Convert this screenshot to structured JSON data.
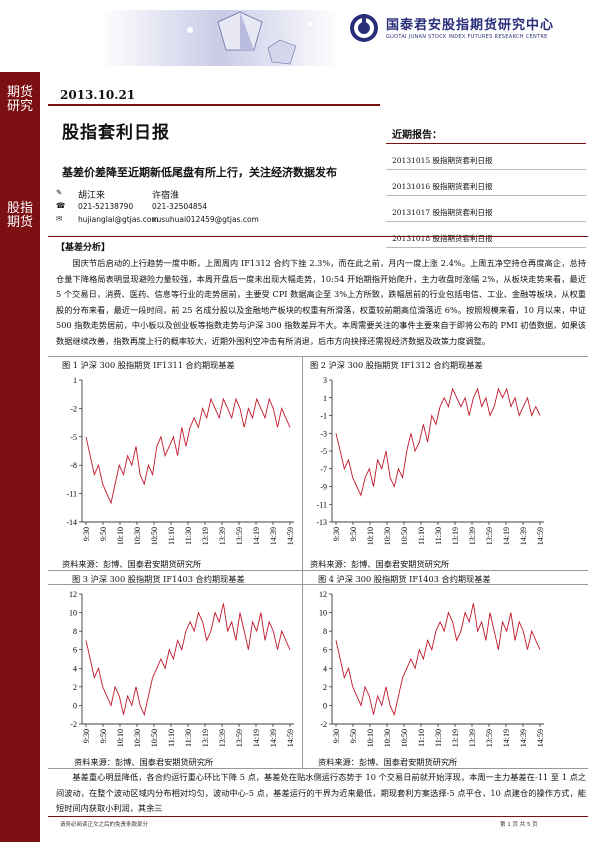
{
  "header": {
    "logo_cn": "国泰君安股指期货研究中心",
    "logo_en": "GUOTAI JUNAN STOCK INDEX FUTURES RESEARCH CENTRE"
  },
  "left_band": {
    "top": "期货研究",
    "bottom": "股指期货"
  },
  "date": "2013.10.21",
  "title": "股指套利日报",
  "subtitle": "基差价差降至近期新低尾盘有所上行，关注经济数据发布",
  "analysts": [
    {
      "name": "胡江来",
      "phone": "021-52138790",
      "email": "hujianglai@gtjas.com"
    },
    {
      "name": "许宿淮",
      "phone": "021-32504854",
      "email": "xusuhuai012459@gtjas.com"
    }
  ],
  "recent": {
    "heading": "近期报告：",
    "items": [
      "20131015 股指期货套利日报",
      "20131016 股指期货套利日报",
      "20131017 股指期货套利日报",
      "20131018 股指期货套利日报"
    ]
  },
  "section_heading": "【基差分析】",
  "para1": "国庆节后启动的上行趋势一度中断，上周周内 IF1312 合约下挫 2.3%，而在此之前，月内一度上涨 2.4%。上周五净空持仓再度高企，总持仓量下降格局表明显现避险力量较强，本周开盘后一度未出现大幅走势，10:54 开始期指开始爬升，主力收盘时涨幅 2%，从板块走势来看，最近 5 个交易日，消费、医药、信息等行业的走势居前，主要受 CPI 数据高企至 3%上方所致，跌幅居前的行业包括电信、工业、金融等板块，从权重股的分布来看，最近一段时间，前 25 名成分股以及金融地产板块的权重有所滑落，权重较前期高位滑落近 6%。按照规模来看，10 月以来，中证 500 指数走势居前，中小板以及创业板等指数走势与沪深 300 指数差异不大。本周需要关注的事件主要来自于即将公布的 PMI 初值数据，如果该数据继续改善，指数再度上行的概率较大，近期外围利空冲击有所消退，后市方向抉择还需视经济数据及政策力度调整。",
  "figures": [
    {
      "title": "图 1 沪深 300 股指期货 IF1311 合约期现基差",
      "source": "资料来源：彭博、国泰君安期货研究所"
    },
    {
      "title": "图 2 沪深 300 股指期货 IF1312 合约期现基差",
      "source": "资料来源：彭博、国泰君安期货研究所"
    },
    {
      "title": "图 3 沪深 300 股指期货 IF1403 合约期现基差",
      "source": "资料来源：彭博、国泰君安期货研究所"
    },
    {
      "title": "图 4 沪深 300 股指期货 IF1403 合约期现基差",
      "source": "资料来源：彭博、国泰君安期货研究所"
    }
  ],
  "para2": "基差重心明显降低，各合约运行重心环比下降 5 点，基差处在贴水侧运行态势于 10 个交易日前就开始浮现，本周一主力基差在-11 至 1 点之间波动，在整个波动区域内分布相对均匀，波动中心-5 点，基差运行的干界为近来最低，期现套利方案选择-5 点平仓，10 点建仓的操作方式，能短时间内获取小利润，其余三",
  "footer": {
    "left": "请务必阅读正文之后的免责条款部分",
    "right": "第 1 页 共 5 页"
  },
  "chart_data": [
    {
      "type": "line",
      "title": "图 1 沪深 300 股指期货 IF1311 合约期现基差",
      "ylim": [
        -14,
        1
      ],
      "yticks": [
        "1",
        "-2",
        "-5",
        "-8",
        "-11",
        "-14"
      ],
      "xticks": [
        "9:30",
        "9:50",
        "10:10",
        "10:30",
        "10:50",
        "11:10",
        "11:30",
        "13:19",
        "13:39",
        "13:59",
        "14:19",
        "14:39",
        "14:59"
      ],
      "series": [
        {
          "values": [
            -5,
            -7,
            -9,
            -8,
            -10,
            -11,
            -12,
            -10,
            -8,
            -9,
            -7,
            -8,
            -6,
            -9,
            -10,
            -8,
            -9,
            -6,
            -5,
            -7,
            -6,
            -5,
            -7,
            -4,
            -6,
            -4,
            -3,
            -4,
            -2,
            -3,
            -1,
            -2,
            -3,
            -1,
            -2,
            -3,
            -1,
            -2,
            -4,
            -2,
            -3,
            -1,
            -2,
            -3,
            -1,
            -2,
            -4,
            -2,
            -3,
            -4
          ]
        }
      ]
    },
    {
      "type": "line",
      "title": "图 2 沪深 300 股指期货 IF1312 合约期现基差",
      "ylim": [
        -13,
        3
      ],
      "yticks": [
        "3",
        "1",
        "-1",
        "-3",
        "-5",
        "-7",
        "-9",
        "-11",
        "-13"
      ],
      "xticks": [
        "9:30",
        "9:50",
        "10:10",
        "10:30",
        "10:50",
        "11:10",
        "11:30",
        "13:19",
        "13:39",
        "13:59",
        "14:19",
        "14:39",
        "14:59"
      ],
      "series": [
        {
          "values": [
            -3,
            -5,
            -7,
            -6,
            -8,
            -9,
            -10,
            -8,
            -7,
            -9,
            -6,
            -7,
            -5,
            -8,
            -9,
            -7,
            -8,
            -5,
            -3,
            -5,
            -4,
            -2,
            -4,
            -1,
            -2,
            0,
            1,
            0,
            2,
            1,
            0,
            1,
            -1,
            1,
            2,
            0,
            1,
            -1,
            0,
            2,
            1,
            2,
            0,
            1,
            -1,
            0,
            1,
            -1,
            0,
            -1
          ]
        }
      ]
    },
    {
      "type": "line",
      "title": "图 3 沪深 300 股指期货 IF1403 合约期现基差",
      "ylim": [
        -2,
        12
      ],
      "yticks": [
        "12",
        "10",
        "8",
        "6",
        "4",
        "2",
        "0",
        "-2"
      ],
      "xticks": [
        "9:30",
        "9:50",
        "10:10",
        "10:30",
        "10:50",
        "11:10",
        "11:30",
        "13:19",
        "13:39",
        "13:59",
        "14:19",
        "14:39",
        "14:59"
      ],
      "series": [
        {
          "values": [
            7,
            5,
            3,
            4,
            2,
            1,
            0,
            2,
            1,
            -1,
            1,
            0,
            2,
            0,
            -1,
            1,
            3,
            4,
            5,
            4,
            6,
            5,
            7,
            6,
            8,
            9,
            8,
            10,
            9,
            7,
            8,
            10,
            9,
            11,
            8,
            9,
            7,
            10,
            8,
            6,
            9,
            8,
            10,
            7,
            9,
            8,
            6,
            8,
            7,
            6
          ]
        }
      ]
    },
    {
      "type": "line",
      "title": "图 4 沪深 300 股指期货 IF1403 合约期现基差",
      "ylim": [
        -2,
        12
      ],
      "yticks": [
        "12",
        "10",
        "8",
        "6",
        "4",
        "2",
        "0",
        "-2"
      ],
      "xticks": [
        "9:30",
        "9:50",
        "10:10",
        "10:30",
        "10:50",
        "11:10",
        "11:30",
        "13:19",
        "13:39",
        "13:59",
        "14:19",
        "14:39",
        "14:59"
      ],
      "series": [
        {
          "values": [
            7,
            5,
            3,
            4,
            2,
            1,
            0,
            2,
            1,
            -1,
            1,
            0,
            2,
            0,
            -1,
            1,
            3,
            4,
            5,
            4,
            6,
            5,
            7,
            6,
            8,
            9,
            8,
            10,
            9,
            7,
            8,
            10,
            9,
            11,
            8,
            9,
            7,
            10,
            8,
            6,
            9,
            8,
            10,
            7,
            9,
            8,
            6,
            8,
            7,
            6
          ]
        }
      ]
    }
  ]
}
